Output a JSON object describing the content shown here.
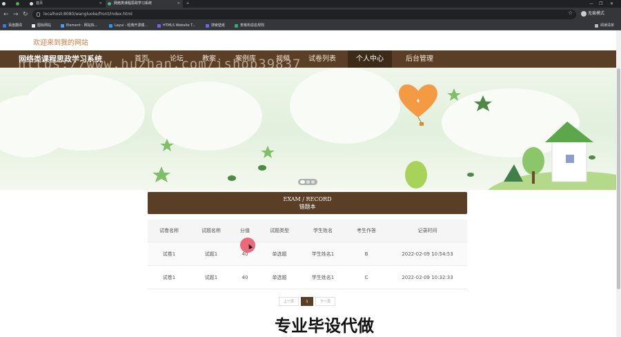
{
  "browser": {
    "tabs": [
      {
        "label": ""
      },
      {
        "label": "首页"
      },
      {
        "label": "网络类课程思政学习系统"
      }
    ],
    "url": "localhost:8080/wangluoke/front/index.html",
    "profile_label": "无痕模式",
    "bookmarks": [
      "百度翻译",
      "图标网站",
      "Element - 网站快...",
      "Layui - 经典开源模...",
      "HTML5 Website T...",
      "搜索壁纸",
      "表格构造名规则"
    ],
    "reading_list": "阅读清单"
  },
  "page": {
    "welcome": "欢迎来到我的网站",
    "site_title": "网络类课程思政学习系统",
    "nav_items": [
      "首页",
      "论坛",
      "教案",
      "案例库",
      "视频",
      "试卷列表",
      "个人中心",
      "后台管理"
    ],
    "active_nav": "个人中心",
    "watermark_url": "https://www.huzhan.com/ishop39837",
    "section": {
      "en": "EXAM / RECORD",
      "cn": "错题本"
    },
    "table": {
      "headers": [
        "试卷名称",
        "试题名称",
        "分值",
        "试题类型",
        "学生姓名",
        "考生作答",
        "记录时间"
      ],
      "rows": [
        [
          "试卷1",
          "试题1",
          "40",
          "单选题",
          "学生姓名1",
          "B",
          "2022-02-09 10:54:53"
        ],
        [
          "试卷1",
          "试题1",
          "40",
          "单选题",
          "学生姓名1",
          "C",
          "2022-02-09 10:32:33"
        ]
      ]
    },
    "pager": {
      "prev": "上一页",
      "current": "1",
      "next": "下一页"
    },
    "big_watermark": "专业毕设代做"
  },
  "colors": {
    "brand": "#5a3e25",
    "brand_dark": "#3d2a18",
    "welcome": "#d4773b"
  }
}
